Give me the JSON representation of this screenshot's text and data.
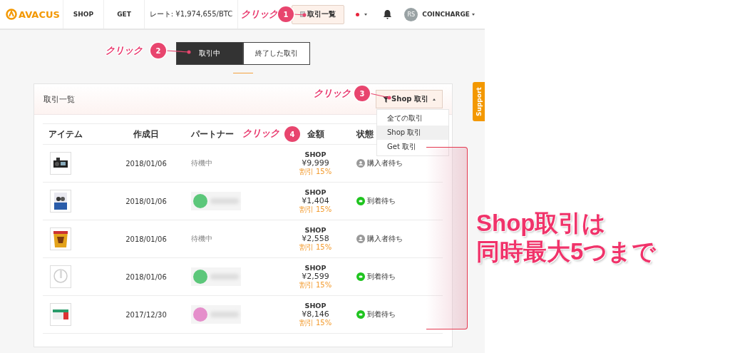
{
  "header": {
    "logo": "AVACUS",
    "nav": [
      {
        "label": "SHOP"
      },
      {
        "label": "GET"
      }
    ],
    "rate": "レート: ¥1,974,655/BTC",
    "trade_list_button": "取引一覧",
    "user": {
      "initials": "RS",
      "name": "COINCHARGE"
    }
  },
  "tabs": [
    {
      "label": "取引中",
      "selected": true
    },
    {
      "label": "終了した取引",
      "selected": false
    }
  ],
  "card": {
    "title": "取引一覧",
    "filter": {
      "label": "Shop 取引",
      "expanded": true,
      "options": [
        {
          "label": "全ての取引",
          "selected": false
        },
        {
          "label": "Shop 取引",
          "selected": true
        },
        {
          "label": "Get 取引",
          "selected": false
        }
      ]
    }
  },
  "table": {
    "columns": [
      "アイテム",
      "作成日",
      "パートナー",
      "金額",
      "状態"
    ],
    "rows": [
      {
        "date": "2018/01/06",
        "partner": {
          "kind": "waiting",
          "text": "待機中"
        },
        "type": "SHOP",
        "price": "¥9,999",
        "discount": "割引 15%",
        "status": {
          "kind": "buyer",
          "text": "購入者待ち"
        }
      },
      {
        "date": "2018/01/06",
        "partner": {
          "kind": "blurred",
          "color": "#5cc77a"
        },
        "type": "SHOP",
        "price": "¥1,404",
        "discount": "割引 15%",
        "status": {
          "kind": "arrival",
          "text": "到着待ち"
        }
      },
      {
        "date": "2018/01/06",
        "partner": {
          "kind": "waiting",
          "text": "待機中"
        },
        "type": "SHOP",
        "price": "¥2,558",
        "discount": "割引 15%",
        "status": {
          "kind": "buyer",
          "text": "購入者待ち"
        }
      },
      {
        "date": "2018/01/06",
        "partner": {
          "kind": "blurred",
          "color": "#5cc77a"
        },
        "type": "SHOP",
        "price": "¥2,599",
        "discount": "割引 15%",
        "status": {
          "kind": "arrival",
          "text": "到着待ち"
        }
      },
      {
        "date": "2017/12/30",
        "partner": {
          "kind": "blurred",
          "color": "#e58fcb"
        },
        "type": "SHOP",
        "price": "¥8,146",
        "discount": "割引 15%",
        "status": {
          "kind": "arrival",
          "text": "到着待ち"
        }
      }
    ]
  },
  "support": "Support",
  "annotations": {
    "clicks": [
      {
        "text": "クリック",
        "number": "1"
      },
      {
        "text": "クリック",
        "number": "2"
      },
      {
        "text": "クリック",
        "number": "3"
      },
      {
        "text": "クリック",
        "number": "4"
      }
    ],
    "note": [
      "Shop取引は",
      "同時最大5つまで"
    ]
  }
}
